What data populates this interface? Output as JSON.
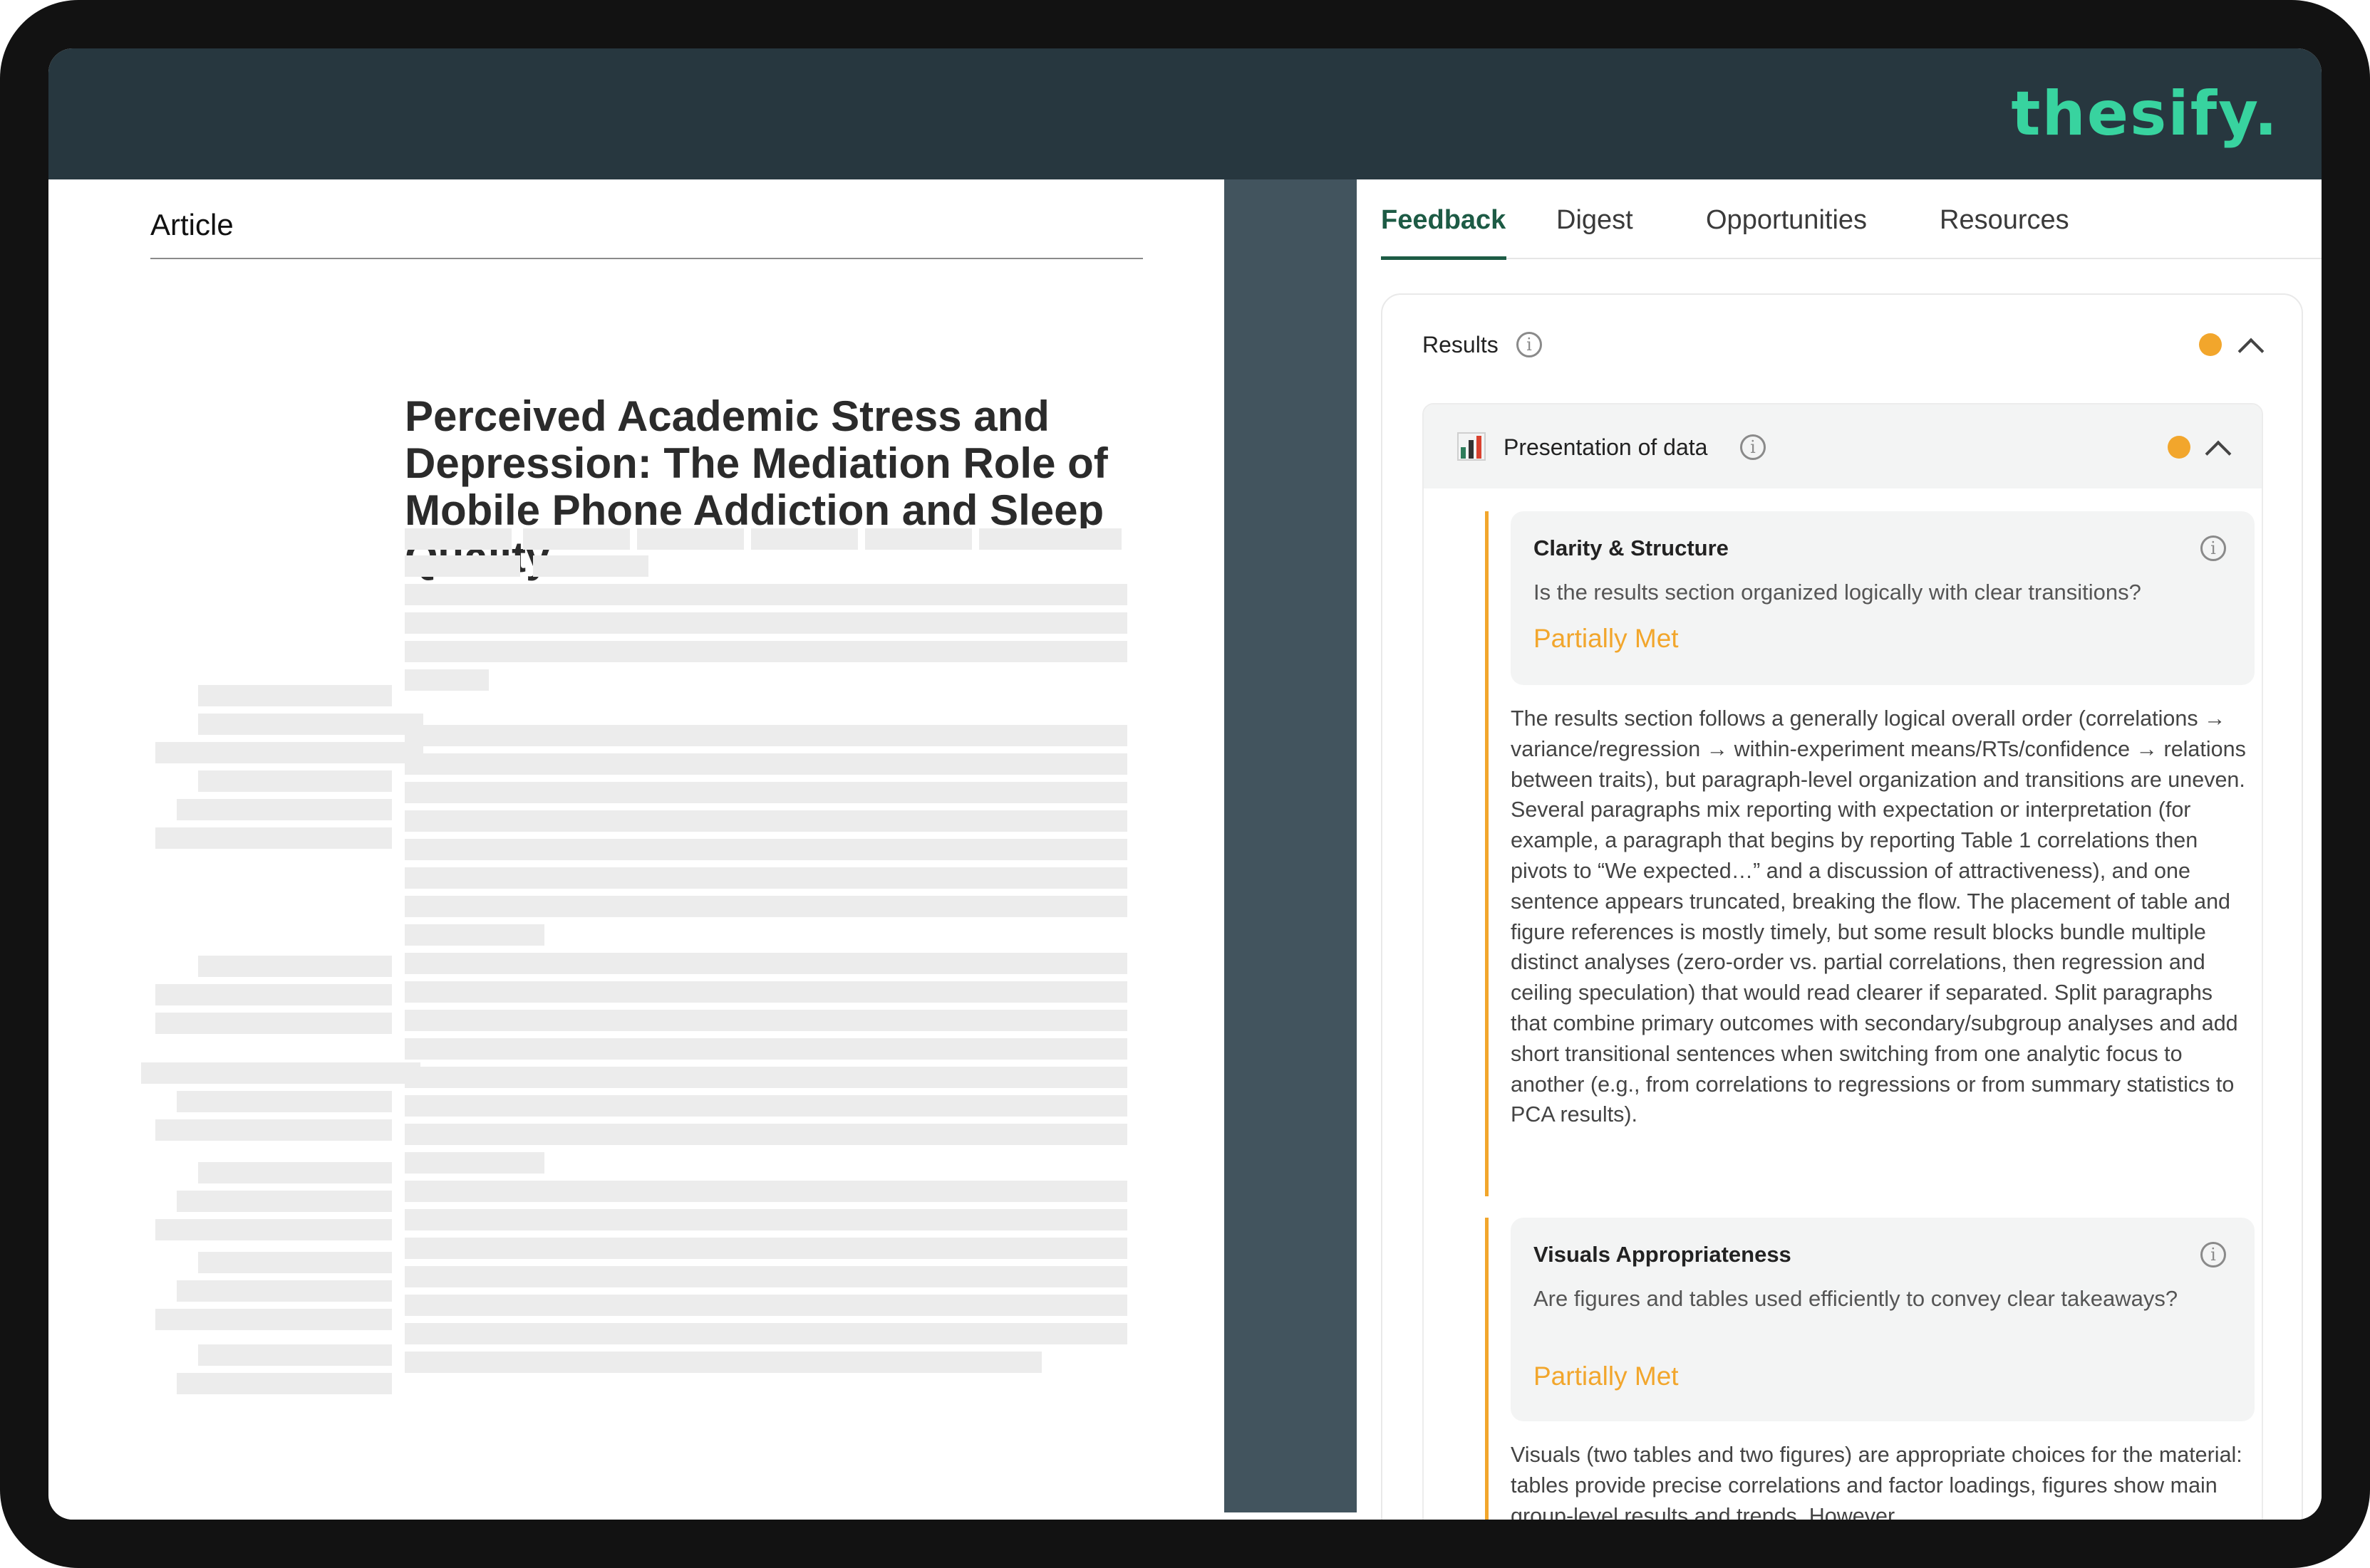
{
  "brand": {
    "logo": "thesify."
  },
  "document": {
    "header": "Article",
    "title": "Perceived Academic Stress and Depression: The Mediation Role of Mobile Phone Addiction and Sleep Quality"
  },
  "panel": {
    "tabs": [
      {
        "label": "Feedback",
        "active": true
      },
      {
        "label": "Digest"
      },
      {
        "label": "Opportunities"
      },
      {
        "label": "Resources"
      }
    ],
    "section": {
      "label": "Results",
      "status_color": "#f2a62c",
      "subsection": {
        "label": "Presentation of data",
        "icon": "bar-chart-icon",
        "criteria": [
          {
            "title": "Clarity & Structure",
            "question": "Is the results section organized logically with clear transitions?",
            "status": "Partially Met",
            "body": "The results section follows a generally logical overall order (correlations → variance/regression → within-experiment means/RTs/confidence → relations between traits), but paragraph-level organization and transitions are uneven. Several paragraphs mix reporting with expectation or interpretation (for example, a paragraph that begins by reporting Table 1 correlations then pivots to “We expected…” and a discussion of attractiveness), and one sentence appears truncated, breaking the flow. The placement of table and figure references is mostly timely, but some result blocks bundle multiple distinct analyses (zero-order vs. partial correlations, then regression and ceiling speculation) that would read clearer if separated. Split paragraphs that combine primary outcomes with secondary/subgroup analyses and add short transitional sentences when switching from one analytic focus to another (e.g., from correlations to regressions or from summary statistics to PCA results)."
          },
          {
            "title": "Visuals Appropriateness",
            "question": "Are figures and tables used efficiently to convey clear takeaways?",
            "status": "Partially Met",
            "body": "Visuals (two tables and two figures) are appropriate choices for the material: tables provide precise correlations and factor loadings, figures show main group-level results and trends. However..."
          }
        ]
      }
    }
  },
  "colors": {
    "brand": "#38d39f",
    "accent": "#1d5b45",
    "warning": "#f2a62c",
    "topbar": "#27373f"
  }
}
